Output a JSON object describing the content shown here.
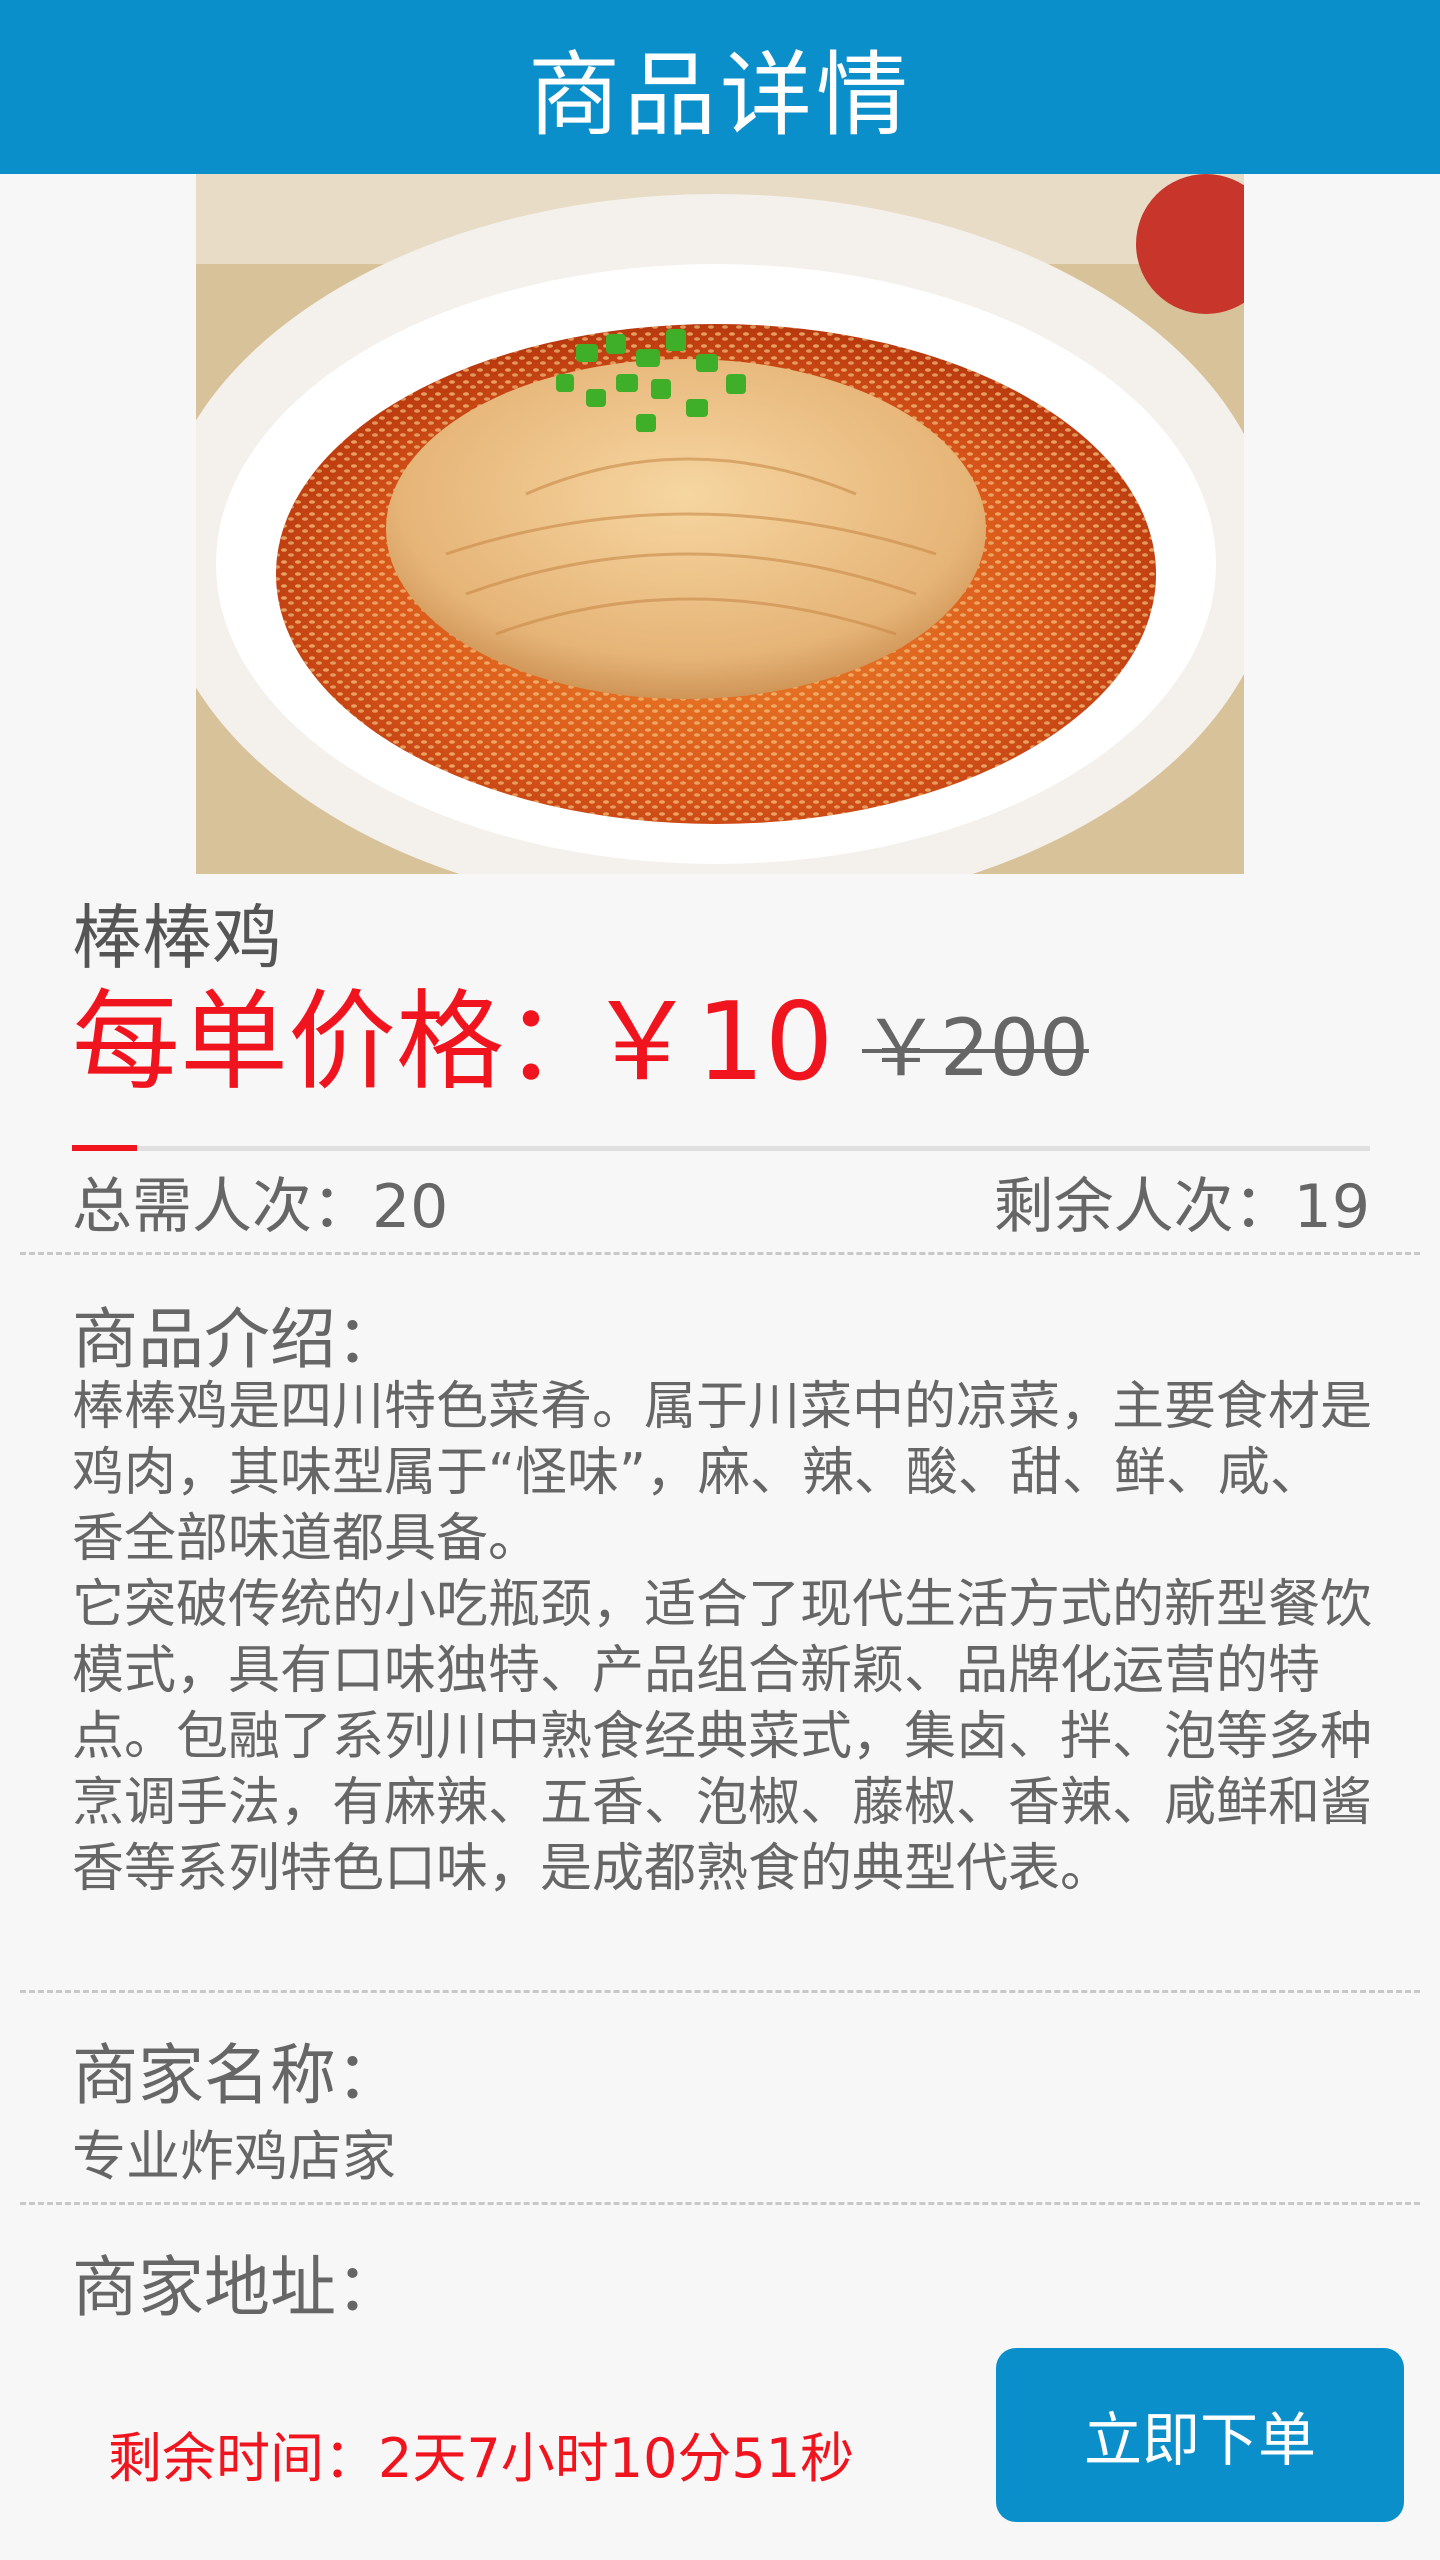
{
  "header": {
    "title": "商品详情"
  },
  "product": {
    "image_alt": "棒棒鸡",
    "name": "棒棒鸡",
    "price_label": "每单价格：",
    "price_current": "￥10",
    "price_original": "￥200"
  },
  "progress": {
    "fraction": 0.05
  },
  "stats": {
    "total": "总需人次：20",
    "remaining": "剩余人次：19"
  },
  "intro": {
    "title": "商品介绍：",
    "paragraphs": [
      "棒棒鸡是四川特色菜肴。属于川菜中的凉菜，主要食材是鸡肉，其味型属于“怪味”，麻、辣、酸、甜、鲜、咸、香全部味道都具备。",
      "它突破传统的小吃瓶颈，适合了现代生活方式的新型餐饮模式，具有口味独特、产品组合新颖、品牌化运营的特点。包融了系列川中熟食经典菜式，集卤、拌、泡等多种烹调手法，有麻辣、五香、泡椒、藤椒、香辣、咸鲜和酱香等系列特色口味，是成都熟食的典型代表。"
    ]
  },
  "merchant": {
    "name_title": "商家名称：",
    "name": "专业炸鸡店家",
    "address_title": "商家地址："
  },
  "bottom": {
    "countdown": "剩余时间：2天7小时10分51秒",
    "order_button": "立即下单"
  },
  "colors": {
    "header_bg": "#0a8fca",
    "price_red": "#f0141e",
    "button_bg": "#0a8fca"
  }
}
